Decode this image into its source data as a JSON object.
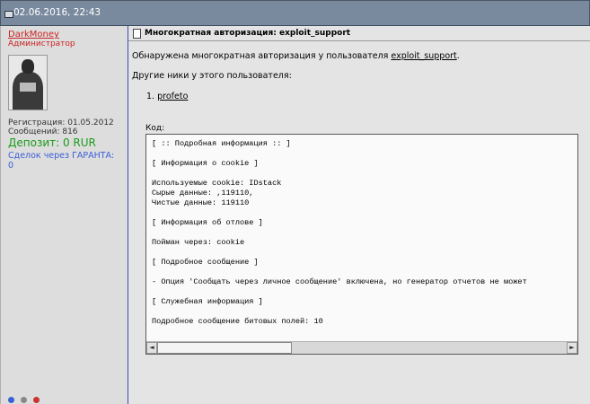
{
  "post": {
    "date": "02.06.2016, 22:43",
    "title": "Многократная авторизация: exploit_support"
  },
  "user": {
    "name": "DarkMoney",
    "rank": "Администратор",
    "registration": "Регистрация: 01.05.2012",
    "messages": "Сообщений: 816",
    "deposit": "Депозит: 0 RUR",
    "guarantee_label": "Сделок через ГАРАНТА:",
    "guarantee_count": "0"
  },
  "body": {
    "detected_prefix": "Обнаружена многократная авторизация у пользователя ",
    "detected_user": "exploit_support",
    "detected_suffix": ".",
    "other_nicks_label": "Другие ники у этого пользователя:",
    "nicks": [
      {
        "num": "1.",
        "name": "profeto"
      }
    ],
    "code_label": "Код:",
    "code_lines": [
      "[ :: Подробная информация :: ]",
      "",
      "[ Информация о cookie ]",
      "",
      "Используемые cookie: IDstack",
      "Сырые данные: ,119110,",
      "Чистые данные: 119110",
      "",
      "[ Информация об отлове ]",
      "",
      "Пойман через: cookie",
      "",
      "[ Подробное сообщение ]",
      "",
      "- Опция 'Сообщать через личное сообщение' включена, но генератор отчетов не может",
      "",
      "[ Служебная информация ]",
      "",
      "Подробное сообщение битовых полей: 10"
    ]
  },
  "icons": {
    "scroll_left": "◄",
    "scroll_right": "►"
  }
}
